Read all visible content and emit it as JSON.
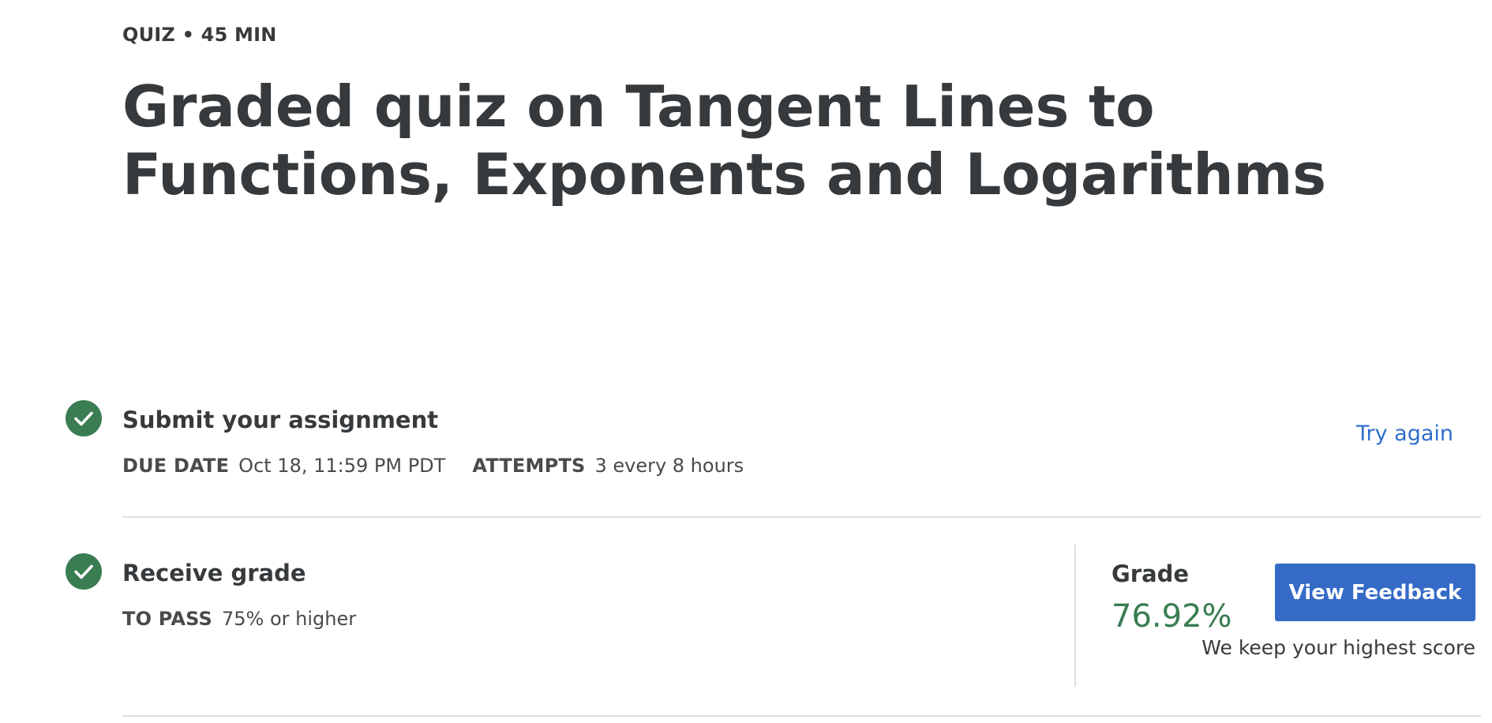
{
  "header": {
    "kicker": "QUIZ • 45 MIN",
    "title": "Graded quiz on Tangent Lines to Functions, Exponents and Logarithms"
  },
  "submit_step": {
    "icon": "check-circle-icon",
    "heading": "Submit your assignment",
    "due_label": "DUE DATE",
    "due_value": "Oct 18, 11:59 PM PDT",
    "attempts_label": "ATTEMPTS",
    "attempts_value": "3 every 8 hours",
    "action_label": "Try again"
  },
  "grade_step": {
    "icon": "check-circle-icon",
    "heading": "Receive grade",
    "pass_label": "TO PASS",
    "pass_value": "75% or higher",
    "grade_label": "Grade",
    "grade_value": "76.92%",
    "button_label": "View Feedback",
    "note": "We keep your highest score"
  },
  "colors": {
    "check_green": "#3a7d52",
    "link_blue": "#2f6fcc",
    "button_blue": "#356bc7",
    "text_dark": "#373a3c"
  }
}
